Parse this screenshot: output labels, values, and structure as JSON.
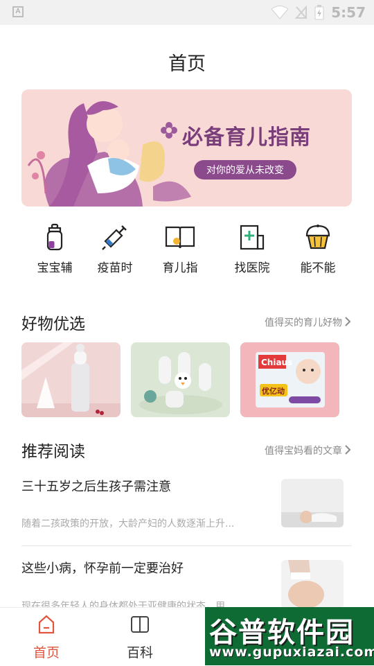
{
  "status_bar": {
    "time": "5:57"
  },
  "header": {
    "title": "首页"
  },
  "banner": {
    "headline": "必备育儿指南",
    "subline": "对你的爱从未改变"
  },
  "categories": [
    {
      "label": "宝宝辅",
      "icon": "baby-bottle-icon"
    },
    {
      "label": "疫苗时",
      "icon": "syringe-icon"
    },
    {
      "label": "育儿指",
      "icon": "open-book-icon"
    },
    {
      "label": "找医院",
      "icon": "hospital-icon"
    },
    {
      "label": "能不能",
      "icon": "cupcake-icon"
    }
  ],
  "goods_section": {
    "title": "好物优选",
    "more": "值得买的育儿好物"
  },
  "goods": [
    {
      "name": "feeding-bottle-product",
      "bg": "#f3d9d9"
    },
    {
      "name": "baby-shoes-product",
      "bg": "#dfe8d9"
    },
    {
      "name": "diaper-product",
      "bg": "#f4b9bd",
      "brand": "Chiaus",
      "package_text": "优亿动"
    }
  ],
  "reading_section": {
    "title": "推荐阅读",
    "more": "值得宝妈看的文章"
  },
  "articles": [
    {
      "title": "三十五岁之后生孩子需注意",
      "desc": "随着二孩政策的开放，大龄产妇的人数逐渐上升..."
    },
    {
      "title": "这些小病，怀孕前一定要治好",
      "desc": "现在很多年轻人的身体都处于亚健康的状态，用..."
    }
  ],
  "tabbar": {
    "tabs": [
      {
        "label": "首页",
        "active": true
      },
      {
        "label": "百科",
        "active": false
      }
    ]
  },
  "watermark": {
    "top": "谷普软件园",
    "bottom": "www.gupuxiazai.com"
  },
  "colors": {
    "accent": "#e0553b",
    "banner_bg": "#f9d9d5",
    "banner_text": "#7a3f7a",
    "watermark_bg": "#0f6b34"
  }
}
